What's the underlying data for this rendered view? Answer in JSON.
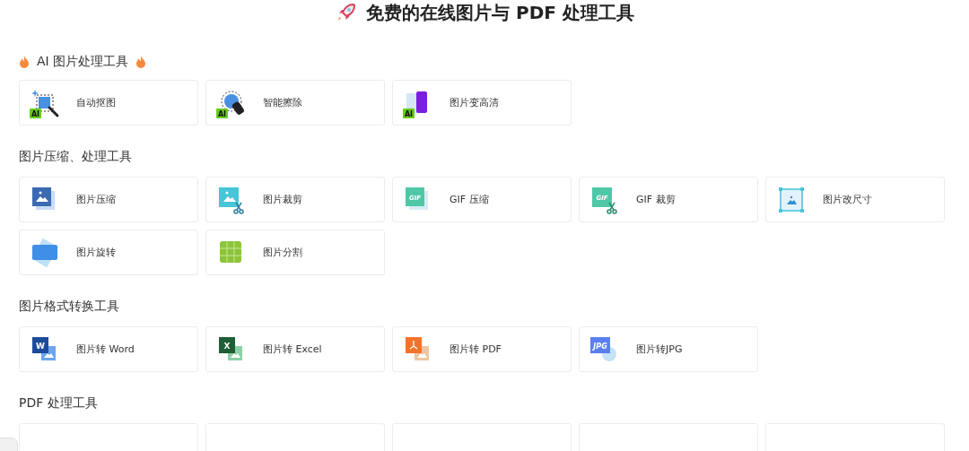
{
  "title": {
    "text": "免费的在线图片与 PDF 处理工具"
  },
  "sections": [
    {
      "heading": "AI 图片处理工具",
      "flames": true,
      "cards": [
        {
          "kind": "cutout",
          "icon_text": "AI",
          "label": "自动抠图"
        },
        {
          "kind": "erase",
          "icon_text": "AI",
          "label": "智能擦除"
        },
        {
          "kind": "enhance",
          "icon_text": "AI",
          "label": "图片变高清"
        }
      ]
    },
    {
      "heading": "图片压缩、处理工具",
      "flames": false,
      "cards": [
        {
          "kind": "compress",
          "label": "图片压缩"
        },
        {
          "kind": "crop",
          "label": "图片裁剪"
        },
        {
          "kind": "gifcompress",
          "icon_text": "GIF",
          "label": "GIF 压缩"
        },
        {
          "kind": "gifcrop",
          "icon_text": "GIF",
          "label": "GIF 裁剪"
        },
        {
          "kind": "resize",
          "label": "图片改尺寸"
        },
        {
          "kind": "rotate",
          "label": "图片旋转"
        },
        {
          "kind": "split",
          "label": "图片分割"
        }
      ]
    },
    {
      "heading": "图片格式转换工具",
      "flames": false,
      "cards": [
        {
          "kind": "word",
          "icon_text": "W",
          "label": "图片转 Word"
        },
        {
          "kind": "excel",
          "icon_text": "X",
          "label": "图片转 Excel"
        },
        {
          "kind": "pdf",
          "label": "图片转 PDF"
        },
        {
          "kind": "jpg",
          "icon_text": "JPG",
          "label": "图片转JPG"
        }
      ]
    },
    {
      "heading": "PDF 处理工具",
      "flames": false,
      "cards": [
        {
          "kind": "blank"
        },
        {
          "kind": "blank"
        },
        {
          "kind": "blank"
        },
        {
          "kind": "blank"
        },
        {
          "kind": "blank"
        }
      ]
    }
  ]
}
